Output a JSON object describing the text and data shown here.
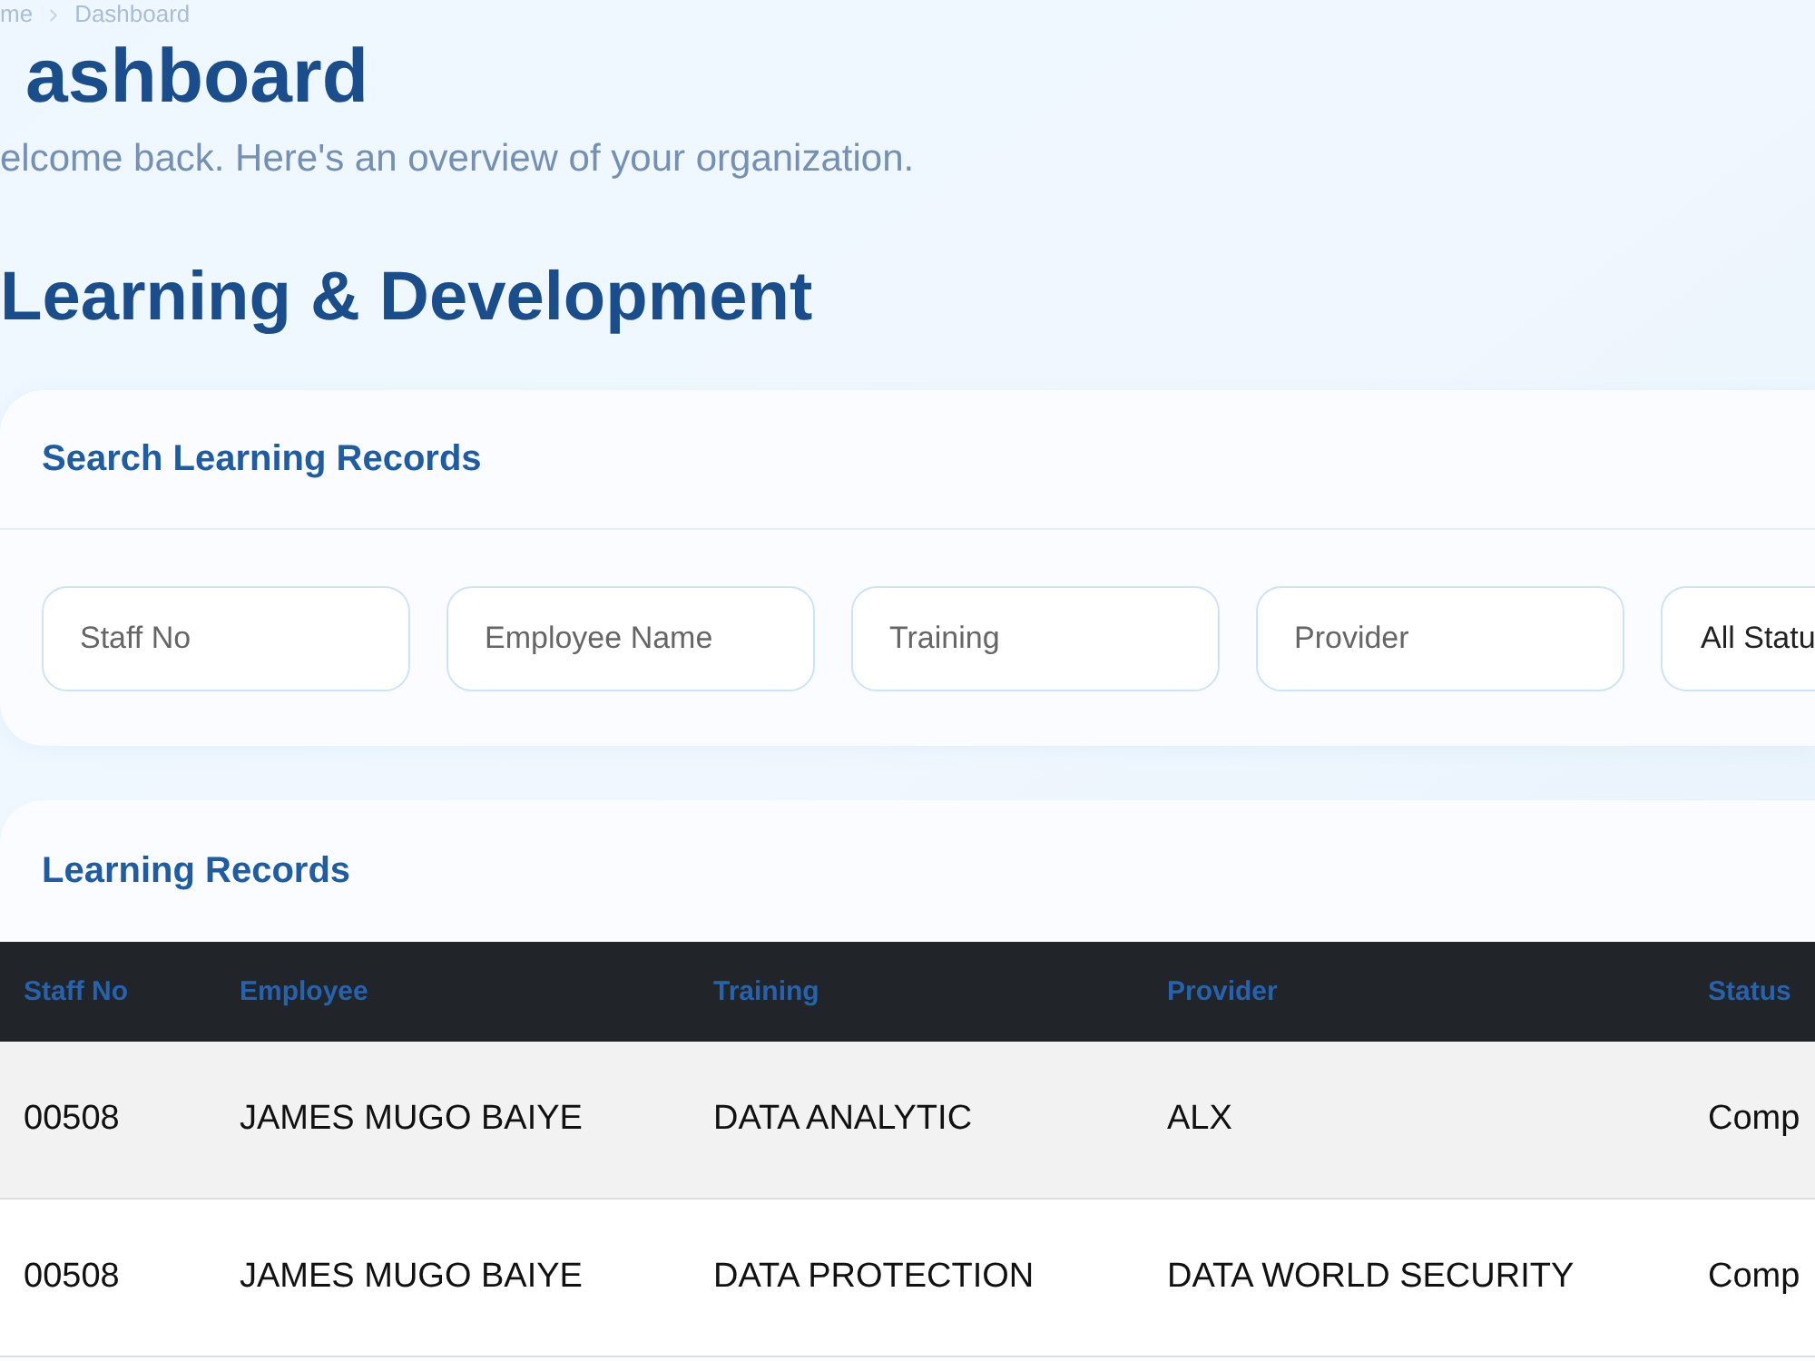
{
  "breadcrumb": [
    {
      "label": "me"
    },
    {
      "label": "Dashboard"
    }
  ],
  "page": {
    "title": "ashboard",
    "subtitle": "elcome back. Here's an overview of your organization."
  },
  "section_title": "Learning & Development",
  "search_card": {
    "title": "Search Learning Records",
    "fields": [
      {
        "kind": "input",
        "placeholder": "Staff No"
      },
      {
        "kind": "input",
        "placeholder": "Employee Name"
      },
      {
        "kind": "input",
        "placeholder": "Training"
      },
      {
        "kind": "input",
        "placeholder": "Provider"
      },
      {
        "kind": "select",
        "value": "All Statu"
      }
    ]
  },
  "records_card": {
    "title": "Learning Records",
    "table": {
      "columns": [
        "Staff No",
        "Employee",
        "Training",
        "Provider",
        "Status"
      ],
      "rows": [
        [
          "00508",
          "JAMES MUGO BAIYE",
          "DATA ANALYTIC",
          "ALX",
          "Comp"
        ],
        [
          "00508",
          "JAMES MUGO BAIYE",
          "DATA PROTECTION",
          "DATA WORLD SECURITY",
          "Comp"
        ]
      ]
    }
  }
}
